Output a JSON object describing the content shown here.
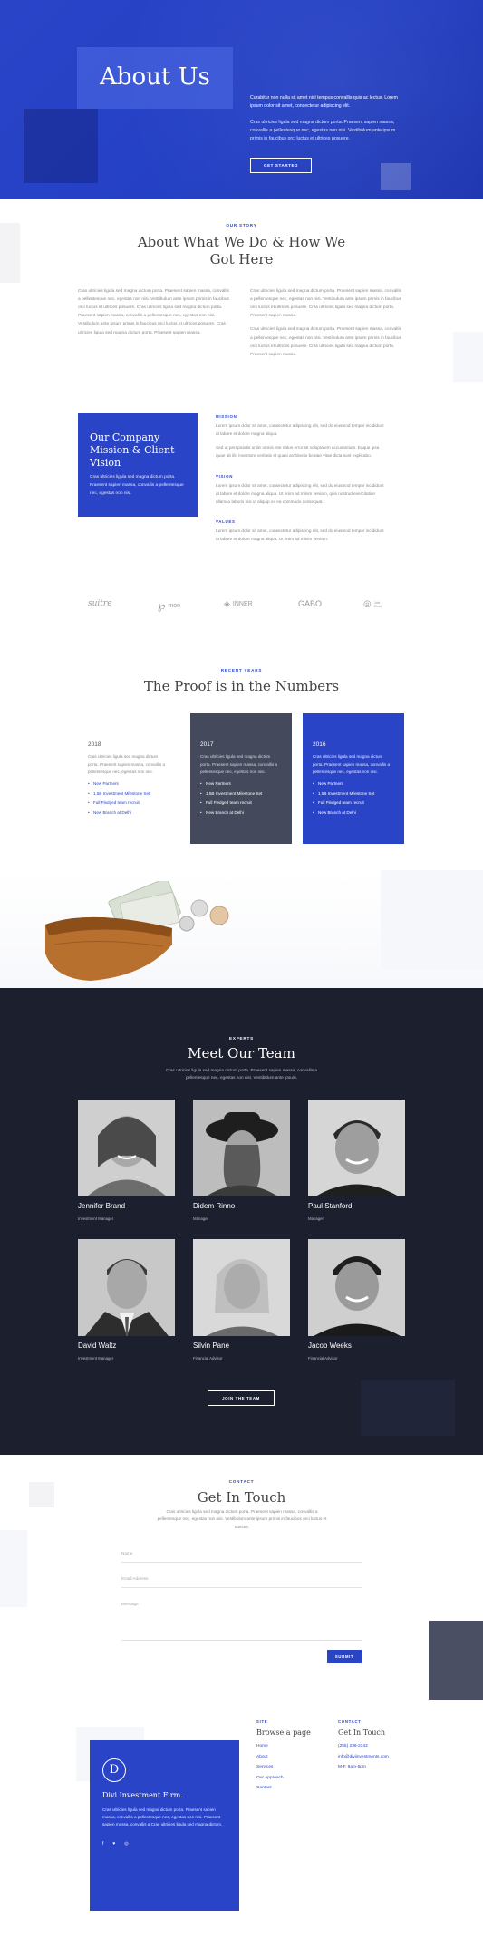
{
  "hero": {
    "title": "About Us",
    "intro": "Curabitur non nulla sit amet nisl tempus convallis quis ac lectus. Lorem ipsum dolor sit amet, consectetur adipiscing elit.",
    "body": "Cras ultricies ligula sed magna dictum porta. Praesent sapien massa, convallis a pellentesque nec, egestas non nisi. Vestibulum ante ipsum primis in faucibus orci luctus et ultrices posuere.",
    "button": "GET STARTED"
  },
  "story": {
    "eyebrow": "OUR STORY",
    "heading": "About What We Do & How We Got Here",
    "col1": "Cras ultricies ligula sed magna dictum porta. Praesent sapien massa, convallis a pellentesque nec, egestas non nisi. Vestibulum ante ipsum primis in faucibus orci luctus et ultrices posuere. Cras ultricies ligula sed magna dictum porta. Praesent sapien massa, convallis a pellentesque nec, egestas non nisi. Vestibulum ante ipsum primis in faucibus orci luctus et ultrices posuere. Cras ultricies ligula sed magna dictum porta. Praesent sapien massa.",
    "col2a": "Cras ultricies ligula sed magna dictum porta. Praesent sapien massa, convallis a pellentesque nec, egestas non nisi. Vestibulum ante ipsum primis in faucibus orci luctus et ultrices posuere. Cras ultricies ligula sed magna dictum porta. Praesent sapien massa.",
    "col2b": "Cras ultricies ligula sed magna dictum porta. Praesent sapien massa, convallis a pellentesque nec, egestas non nisi. Vestibulum ante ipsum primis in faucibus orci luctus et ultrices posuere. Cras ultricies ligula sed magna dictum porta. Praesent sapien massa."
  },
  "mission_card": {
    "title": "Our Company Mission & Client Vision",
    "text": "Cras ultricies ligula sed magna dictum porta. Praesent sapien massa, convallis a pellentesque nec, egestas non nisi."
  },
  "mission": {
    "label": "MISSION",
    "text1": "Lorem ipsum dolor sit amet, consectetur adipiscing elit, sed do eiusmod tempor incididunt ut labore et dolore magna aliqua.",
    "text2": "Sed ut perspiciatis unde omnis iste natus error sit voluptatem accusantium. Eaque ipsa quae ab illo inventore veritatis et quasi architecto beatae vitae dicta sunt explicabo."
  },
  "vision": {
    "label": "VISION",
    "text": "Lorem ipsum dolor sit amet, consectetur adipiscing elit, sed do eiusmod tempor incididunt ut labore et dolore magna aliqua. Ut enim ad minim veniam, quis nostrud exercitation ullamco laboris nisi ut aliquip ex ea commodo consequat."
  },
  "values": {
    "label": "VALUES",
    "text": "Lorem ipsum dolor sit amet, consectetur adipiscing elit, sed do eiusmod tempor incididunt ut labore et dolore magna aliqua. Ut enim ad minim veniam."
  },
  "logos": [
    "suitre",
    "mon",
    "INNER",
    "GABO",
    "Job Core"
  ],
  "numbers": {
    "eyebrow": "RECENT YEARS",
    "heading": "The Proof is in the Numbers",
    "cards": [
      {
        "year": "2018",
        "text": "Cras ultricies ligula sed magna dictum porta. Praesent sapien massa, convallis a pellentesque nec, egestas non nisi.",
        "items": [
          "New Partners",
          "1.5B Investment Milestone Set",
          "Full Fledged team recruit",
          "New Branch at Delhi"
        ]
      },
      {
        "year": "2017",
        "text": "Cras ultricies ligula sed magna dictum porta. Praesent sapien massa, convallis a pellentesque nec, egestas non nisi.",
        "items": [
          "New Partners",
          "1.5B Investment Milestone Set",
          "Full Fledged team recruit",
          "New Branch at Delhi"
        ]
      },
      {
        "year": "2016",
        "text": "Cras ultricies ligula sed magna dictum porta. Praesent sapien massa, convallis a pellentesque nec, egestas non nisi.",
        "items": [
          "New Partners",
          "1.5B Investment Milestone Set",
          "Full Fledged team recruit",
          "New Branch at Delhi"
        ]
      }
    ]
  },
  "team": {
    "eyebrow": "EXPERTS",
    "heading": "Meet Our Team",
    "sub": "Cras ultricies ligula sed magna dictum porta. Praesent sapien massa, convallis a pellentesque nec, egestas non nisi. Vestibulum ante ipsum.",
    "members": [
      {
        "name": "Jennifer Brand",
        "role": "Investment Manager"
      },
      {
        "name": "Didem Rinno",
        "role": "Manager"
      },
      {
        "name": "Paul Stanford",
        "role": "Manager"
      },
      {
        "name": "David Waltz",
        "role": "Investment Manager"
      },
      {
        "name": "Silvin Pane",
        "role": "Financial Advisor"
      },
      {
        "name": "Jacob Weeks",
        "role": "Financial Advisor"
      }
    ],
    "button": "JOIN THE TEAM"
  },
  "contact": {
    "eyebrow": "CONTACT",
    "heading": "Get In Touch",
    "sub": "Cras ultricies ligula sed magna dictum porta. Praesent sapien massa, convallis a pellentesque nec, egestas non nisi. Vestibulum ante ipsum primis in faucibus orci luctus et ultrices.",
    "name_placeholder": "Name",
    "email_placeholder": "Email Address",
    "message_placeholder": "Message",
    "submit": "SUBMIT"
  },
  "footer": {
    "logo_letter": "D",
    "firm": "Divi Investment Firm.",
    "text": "Cras ultricies ligula sed magna dictum porta. Praesent sapien massa, convallis a pellentesque nec, egestas non nisi. Praesent sapien massa, convallis a Cras ultricies ligula sed magna dictum.",
    "site_label": "SITE",
    "site_title": "Browse a page",
    "links": [
      "Home",
      "About",
      "Services",
      "Our Approach",
      "Contact"
    ],
    "contact_label": "CONTACT",
    "contact_title": "Get In Touch",
    "phone": "(255) 236-2342",
    "email": "info@diviinvestments.com",
    "hours": "M-F, 8am-5pm"
  },
  "colors": {
    "brand_blue": "#2a44c8",
    "dark_navy": "#1b1f2e",
    "slate_card": "#444a5c"
  }
}
